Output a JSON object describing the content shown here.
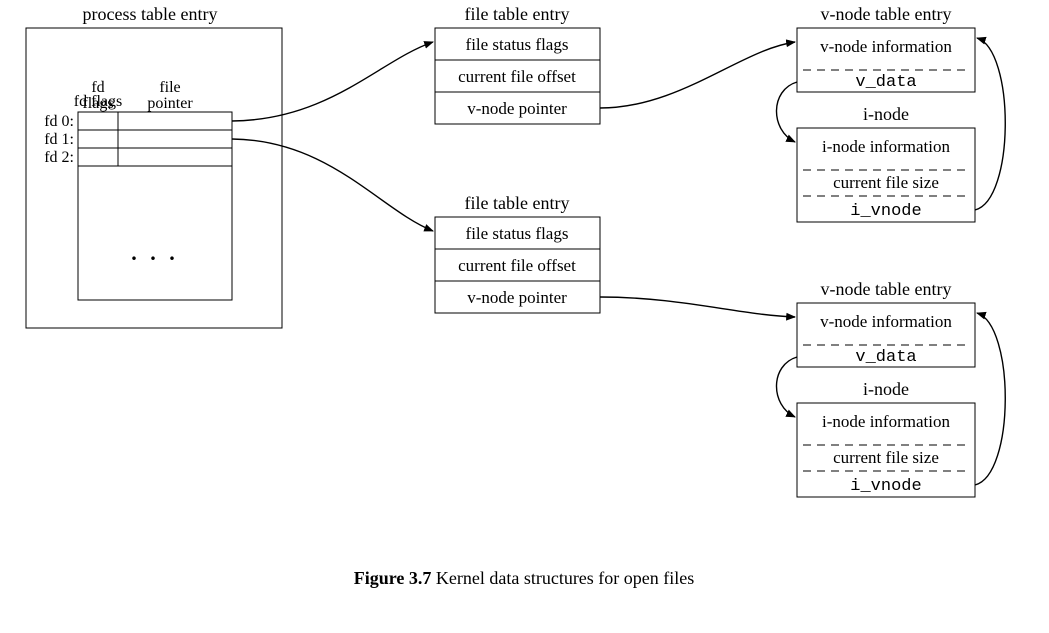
{
  "process_table": {
    "title": "process table entry",
    "col_headers": {
      "fd_flags": "fd flags",
      "file_pointer": "file pointer"
    },
    "rows": [
      "fd 0:",
      "fd 1:",
      "fd 2:"
    ],
    "ellipsis": ". . ."
  },
  "file_table_1": {
    "title": "file table entry",
    "rows": [
      "file status flags",
      "current file offset",
      "v-node pointer"
    ]
  },
  "file_table_2": {
    "title": "file table entry",
    "rows": [
      "file status flags",
      "current file offset",
      "v-node pointer"
    ]
  },
  "vnode_1": {
    "title": "v-node table entry",
    "row1": "v-node information",
    "row2": "v_data"
  },
  "inode_1": {
    "title": "i-node",
    "row1": "i-node information",
    "row2": "current file size",
    "row3": "i_vnode"
  },
  "vnode_2": {
    "title": "v-node table entry",
    "row1": "v-node information",
    "row2": "v_data"
  },
  "inode_2": {
    "title": "i-node",
    "row1": "i-node information",
    "row2": "current file size",
    "row3": "i_vnode"
  },
  "caption": {
    "label": "Figure 3.7",
    "text": "Kernel data structures for open files"
  }
}
